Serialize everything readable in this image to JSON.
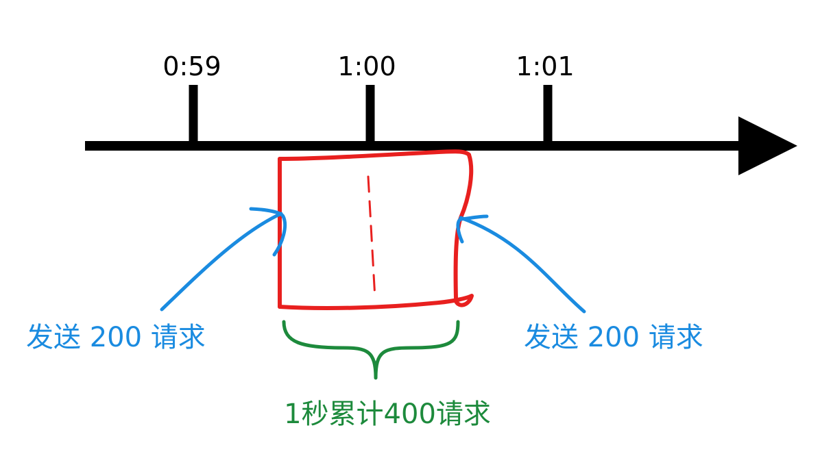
{
  "timeline": {
    "ticks": [
      "0:59",
      "1:00",
      "1:01"
    ]
  },
  "annotations": {
    "left_label": "发送 200 请求",
    "right_label": "发送 200 请求",
    "bottom_label": "1秒累计400请求"
  },
  "colors": {
    "axis": "#000000",
    "window": "#e8201f",
    "arrows": "#1a8be0",
    "brace": "#1d8a3c"
  }
}
